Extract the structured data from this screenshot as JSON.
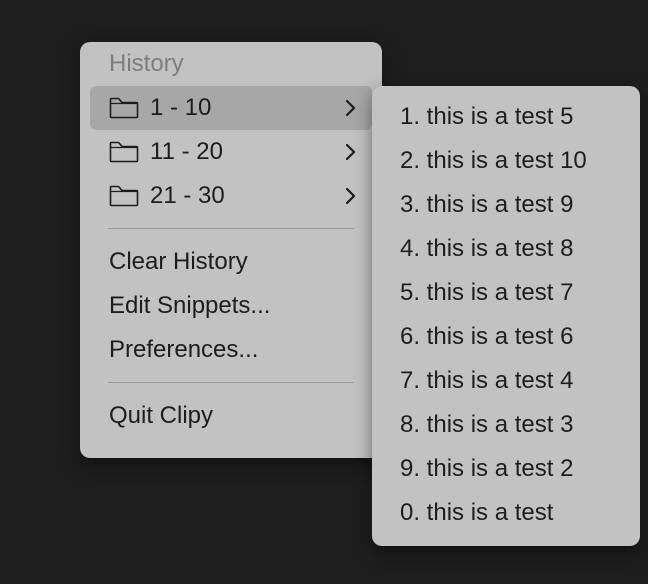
{
  "main_menu": {
    "header": "History",
    "folders": [
      {
        "label": "1 - 10",
        "highlighted": true
      },
      {
        "label": "11 - 20",
        "highlighted": false
      },
      {
        "label": "21 - 30",
        "highlighted": false
      }
    ],
    "actions": [
      "Clear History",
      "Edit Snippets...",
      "Preferences..."
    ],
    "quit": "Quit Clipy"
  },
  "sub_menu": {
    "items": [
      "1. this is a test 5",
      "2. this is a test 10",
      "3. this is a test 9",
      "4. this is a test 8",
      "5. this is a test 7",
      "6. this is a test 6",
      "7. this is a test 4",
      "8. this is a test 3",
      "9. this is a test 2",
      "0. this is a test"
    ]
  },
  "colors": {
    "background": "#1e1e1e",
    "menu": "#c2c2c2",
    "highlight": "#a7a7a7",
    "text": "#1d1d1d",
    "disabled_text": "#7d7d7d"
  },
  "icons": {
    "folder": "folder-icon",
    "submenu": "chevron-right-icon"
  }
}
